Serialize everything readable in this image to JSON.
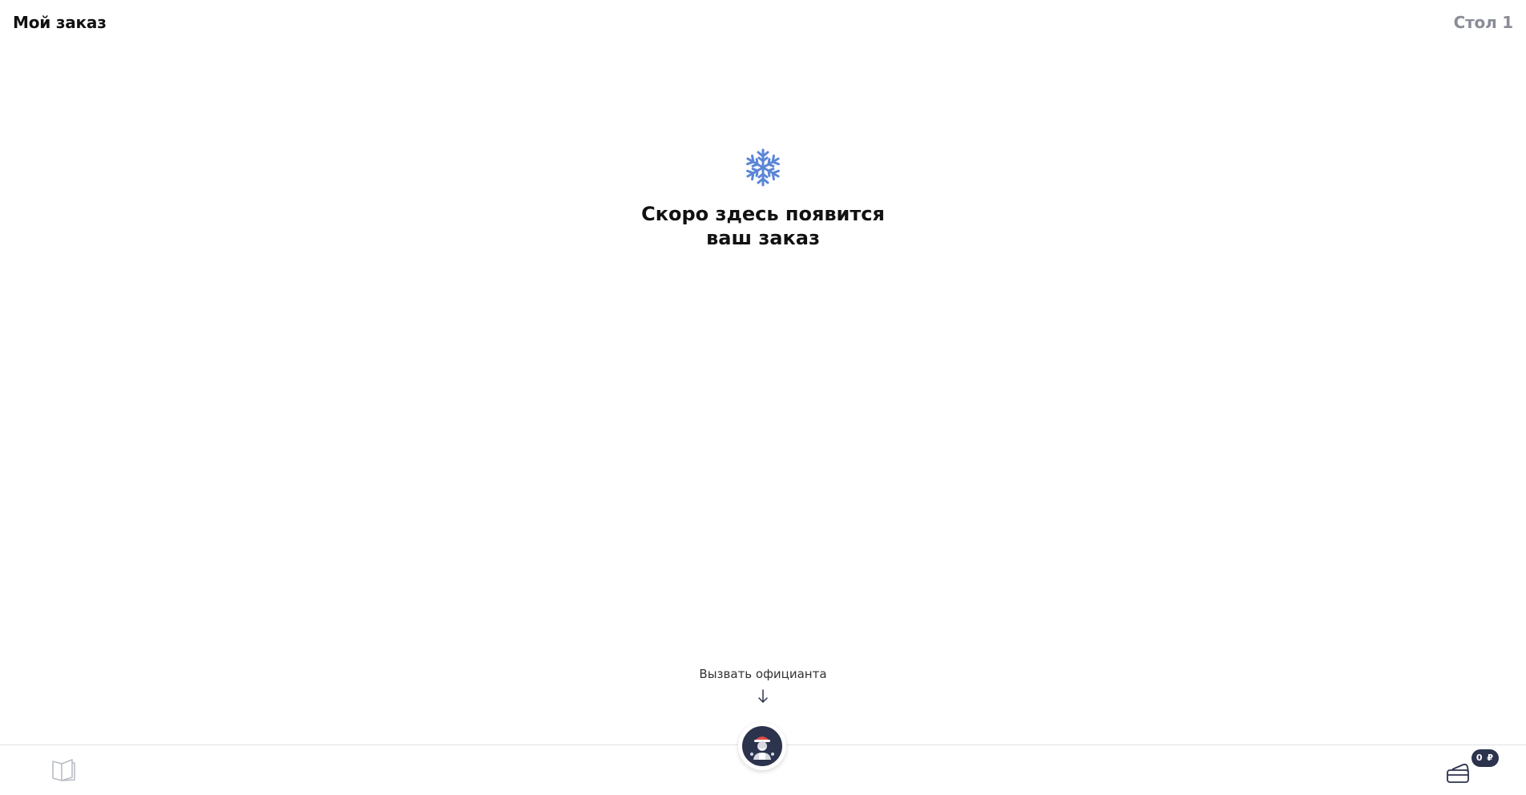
{
  "header": {
    "title": "Мой заказ",
    "table": "Стол 1"
  },
  "empty_state": {
    "icon": "snowflake-icon",
    "line1": "Скоро здесь появится",
    "line2": "ваш заказ"
  },
  "call_waiter": {
    "label": "Вызвать официанта",
    "icon": "waiter-avatar-icon"
  },
  "bottom_nav": {
    "menu_icon": "book-icon",
    "payment_icon": "card-icon",
    "payment_badge": "0 ₽"
  },
  "colors": {
    "accent": "#5b86d6",
    "badge": "#2b334d",
    "muted": "#8a8d97"
  }
}
